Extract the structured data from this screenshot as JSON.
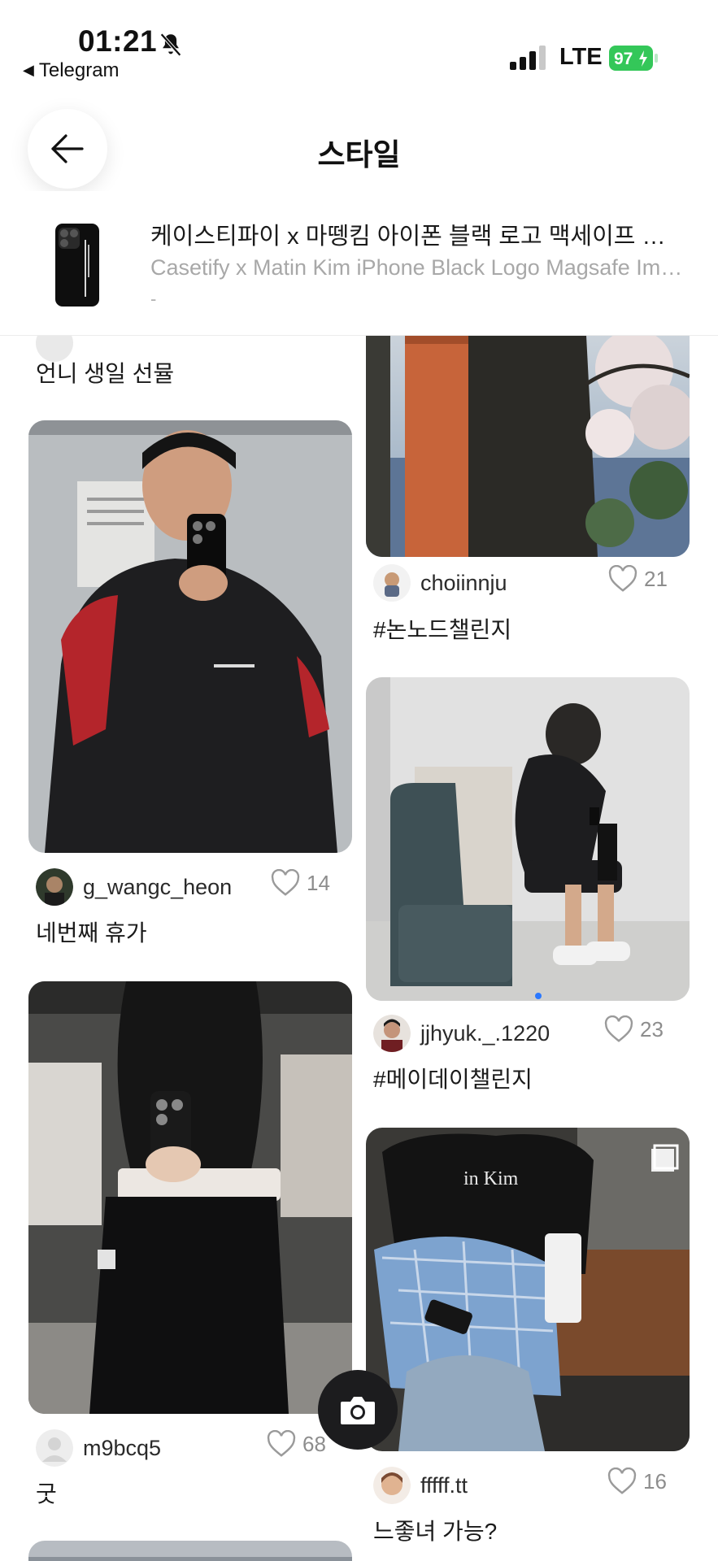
{
  "status_bar": {
    "time": "01:21",
    "back_app": "Telegram",
    "network": "LTE",
    "battery": "97",
    "battery_color": "#34c759"
  },
  "header": {
    "title": "스타일",
    "back_icon": "arrow-left-icon"
  },
  "product": {
    "title_ko": "케이스티파이 x 마뗑킴 아이폰 블랙 로고 맥세이프 임팩트 케이스",
    "title_en": "Casetify x Matin Kim iPhone Black Logo Magsafe Impact Case",
    "price": "-"
  },
  "posts": [
    {
      "id": "top-left",
      "caption": "언니 생일 선뮬"
    },
    {
      "id": "p1",
      "username": "choiinnju",
      "likes": "21",
      "caption": "#논노드챌린지"
    },
    {
      "id": "p2",
      "username": "g_wangc_heon",
      "likes": "14",
      "caption": "네번째 휴가"
    },
    {
      "id": "p3",
      "username": "jjhyuk._.1220",
      "likes": "23",
      "caption": "#메이데이챌린지"
    },
    {
      "id": "p4",
      "username": "m9bcq5",
      "likes": "68",
      "caption": "굿"
    },
    {
      "id": "p5",
      "username": "fffff.tt",
      "likes": "16",
      "caption": "느좋녀 가능?"
    }
  ],
  "camera_button": {
    "icon": "camera-icon"
  },
  "colors": {
    "accent": "#1c1c1e",
    "like_gray": "#8d8d8d"
  }
}
